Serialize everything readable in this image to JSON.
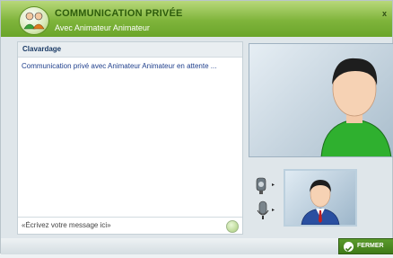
{
  "window": {
    "title": "COMMUNICATION PRIVÉE",
    "subtitle": "Avec Animateur Animateur",
    "close": "x"
  },
  "chat": {
    "header": "Clavardage",
    "messages": [
      "Communication privé avec Animateur Animateur en attente ..."
    ],
    "input_placeholder": "«Écrivez votre message ici»"
  },
  "controls": {
    "speaker_icon": "speaker-icon",
    "microphone_icon": "microphone-icon",
    "send_icon": "send-icon"
  },
  "footer": {
    "close_label": "FERMER"
  },
  "colors": {
    "title_green": "#7fb43b",
    "title_text": "#2e5d0c",
    "shirt_green": "#2fb02f",
    "suit_blue": "#2a4fa0",
    "button_green": "#4a8a22"
  }
}
